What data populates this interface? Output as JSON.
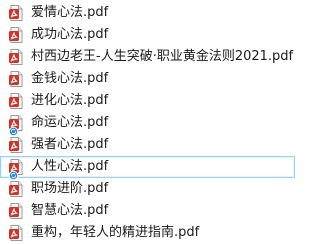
{
  "files": [
    {
      "name": "爱情心法.pdf",
      "icon": "pdf-icon",
      "selected": false,
      "badge": null
    },
    {
      "name": "成功心法.pdf",
      "icon": "pdf-icon",
      "selected": false,
      "badge": null
    },
    {
      "name": "村西边老王-人生突破·职业黄金法则2021.pdf",
      "icon": "pdf-icon",
      "selected": false,
      "badge": null
    },
    {
      "name": "金钱心法.pdf",
      "icon": "pdf-icon",
      "selected": false,
      "badge": null
    },
    {
      "name": "进化心法.pdf",
      "icon": "pdf-icon",
      "selected": false,
      "badge": null
    },
    {
      "name": "命运心法.pdf",
      "icon": "pdf-icon",
      "selected": false,
      "badge": "sync-icon"
    },
    {
      "name": "强者心法.pdf",
      "icon": "pdf-icon",
      "selected": false,
      "badge": null
    },
    {
      "name": "人性心法.pdf",
      "icon": "pdf-icon",
      "selected": true,
      "badge": "sync-icon"
    },
    {
      "name": "职场进阶.pdf",
      "icon": "pdf-icon",
      "selected": false,
      "badge": null
    },
    {
      "name": "智慧心法.pdf",
      "icon": "pdf-icon",
      "selected": false,
      "badge": null
    },
    {
      "name": "重构，年轻人的精进指南.pdf",
      "icon": "pdf-icon",
      "selected": false,
      "badge": null
    }
  ],
  "colors": {
    "pdf_red": "#d93025",
    "selection_border": "#99d1ff",
    "sync_blue": "#1e88e5"
  }
}
